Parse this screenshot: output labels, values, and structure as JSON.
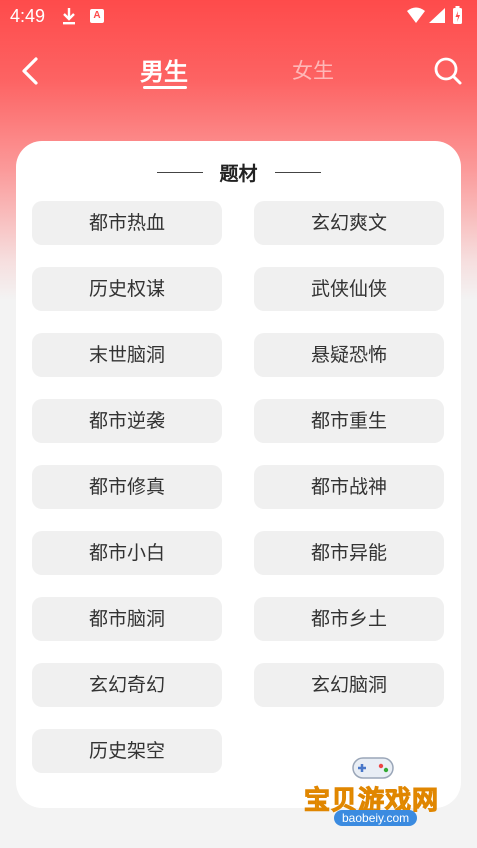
{
  "status_bar": {
    "time": "4:49"
  },
  "nav": {
    "tabs": [
      {
        "label": "男生",
        "active": true
      },
      {
        "label": "女生",
        "active": false
      }
    ]
  },
  "card": {
    "title": "题材",
    "tags": [
      "都市热血",
      "玄幻爽文",
      "历史权谋",
      "武侠仙侠",
      "末世脑洞",
      "悬疑恐怖",
      "都市逆袭",
      "都市重生",
      "都市修真",
      "都市战神",
      "都市小白",
      "都市异能",
      "都市脑洞",
      "都市乡土",
      "玄幻奇幻",
      "玄幻脑洞",
      "历史架空"
    ]
  },
  "watermark": {
    "name": "宝贝游戏网",
    "url": "baobeiy.com"
  },
  "colors": {
    "accent": "#fe4b4b",
    "card_bg": "#ffffff",
    "tag_bg": "#f0f0f0",
    "page_bg": "#f3f3f3"
  },
  "icons": [
    "download-icon",
    "app-notification-icon",
    "wifi-icon",
    "signal-icon",
    "battery-icon",
    "back-arrow-icon",
    "search-icon"
  ]
}
